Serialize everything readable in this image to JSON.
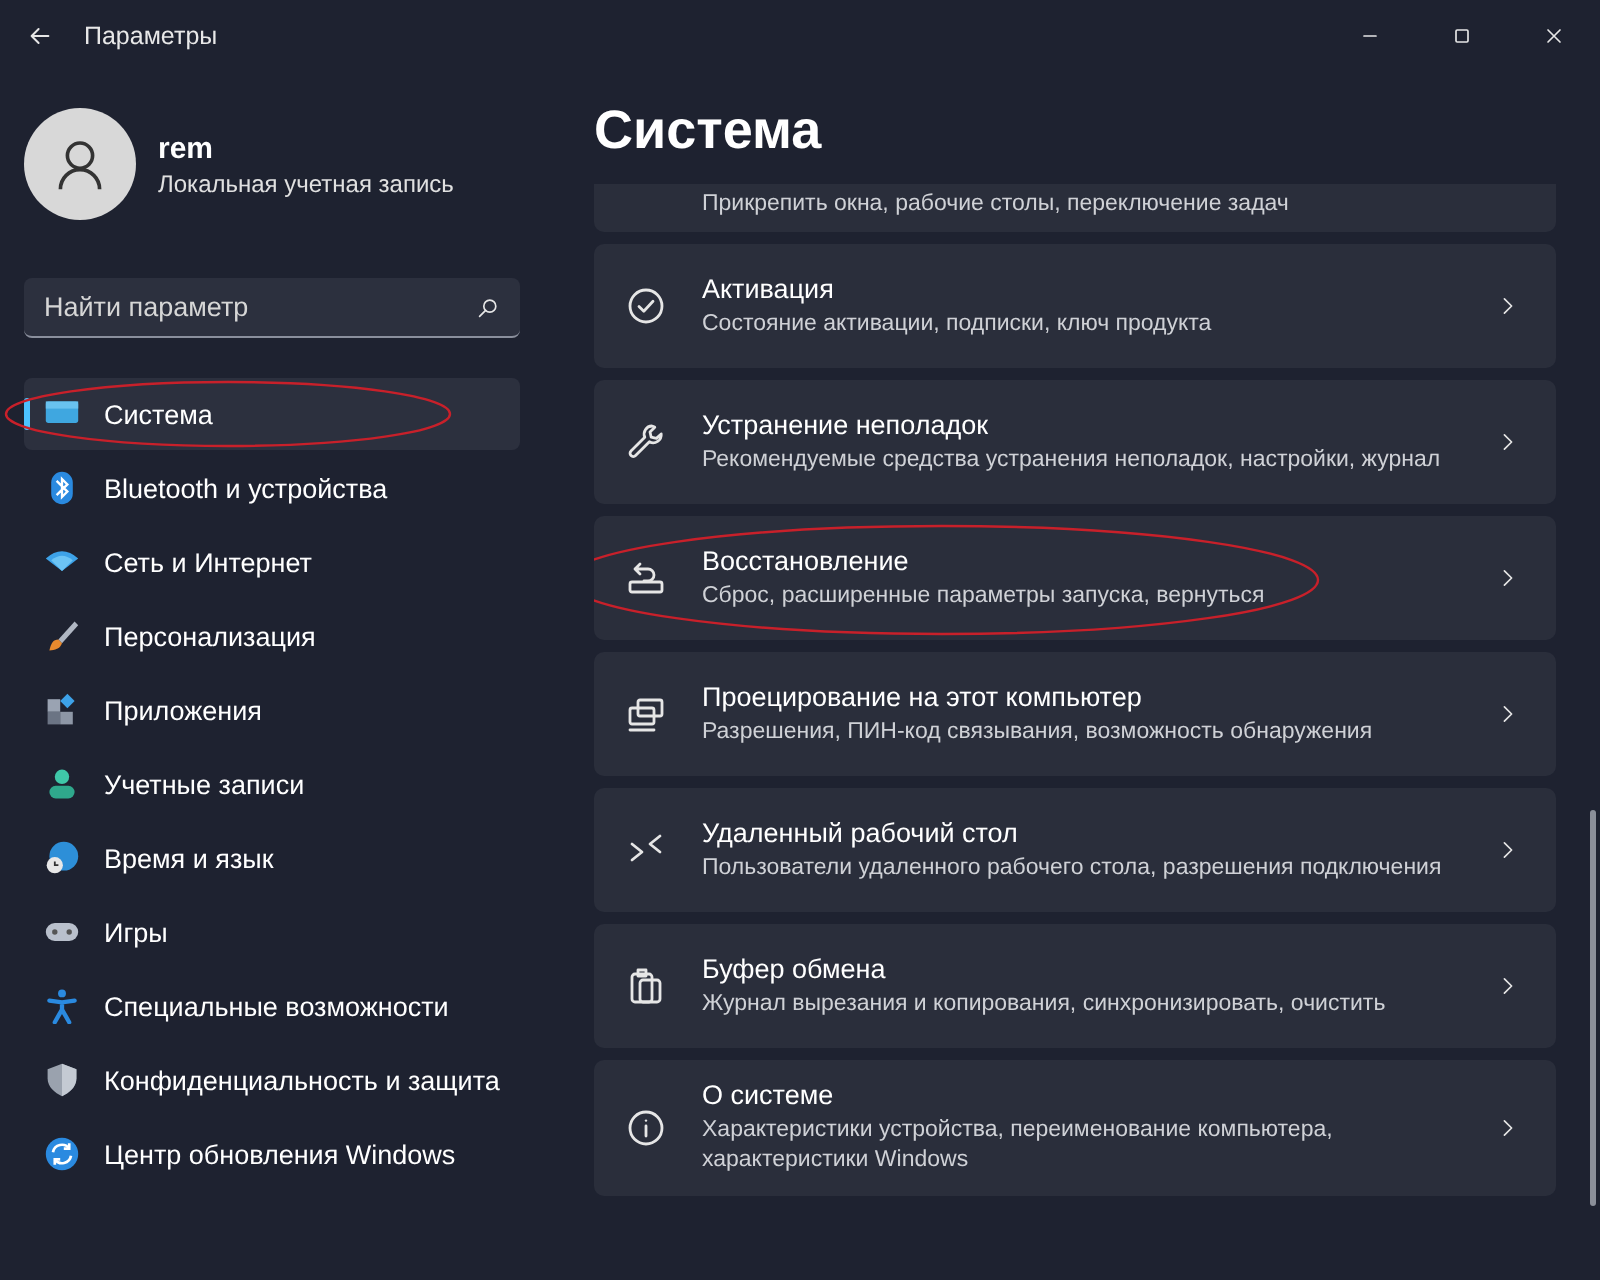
{
  "window": {
    "title": "Параметры"
  },
  "account": {
    "name": "rem",
    "type": "Локальная учетная запись"
  },
  "search": {
    "placeholder": "Найти параметр"
  },
  "nav": [
    {
      "label": "Система",
      "selected": true,
      "annotated": true
    },
    {
      "label": "Bluetooth и устройства",
      "selected": false,
      "annotated": false
    },
    {
      "label": "Сеть и Интернет",
      "selected": false,
      "annotated": false
    },
    {
      "label": "Персонализация",
      "selected": false,
      "annotated": false
    },
    {
      "label": "Приложения",
      "selected": false,
      "annotated": false
    },
    {
      "label": "Учетные записи",
      "selected": false,
      "annotated": false
    },
    {
      "label": "Время и язык",
      "selected": false,
      "annotated": false
    },
    {
      "label": "Игры",
      "selected": false,
      "annotated": false
    },
    {
      "label": "Специальные возможности",
      "selected": false,
      "annotated": false
    },
    {
      "label": "Конфиденциальность и защита",
      "selected": false,
      "annotated": false
    },
    {
      "label": "Центр обновления Windows",
      "selected": false,
      "annotated": false
    }
  ],
  "page": {
    "title": "Система"
  },
  "cards": [
    {
      "kind": "partial",
      "subtitle": "Прикрепить окна, рабочие столы, переключение задач"
    },
    {
      "kind": "full",
      "title": "Активация",
      "subtitle": "Состояние активации, подписки, ключ продукта",
      "annotated": false
    },
    {
      "kind": "full",
      "title": "Устранение неполадок",
      "subtitle": "Рекомендуемые средства устранения неполадок, настройки, журнал",
      "annotated": false
    },
    {
      "kind": "full",
      "title": "Восстановление",
      "subtitle": "Сброс, расширенные параметры запуска, вернуться",
      "annotated": true
    },
    {
      "kind": "full",
      "title": "Проецирование на этот компьютер",
      "subtitle": "Разрешения, ПИН-код связывания, возможность обнаружения",
      "annotated": false
    },
    {
      "kind": "full",
      "title": "Удаленный рабочий стол",
      "subtitle": "Пользователи удаленного рабочего стола, разрешения подключения",
      "annotated": false
    },
    {
      "kind": "full",
      "title": "Буфер обмена",
      "subtitle": "Журнал вырезания и копирования, синхронизировать, очистить",
      "annotated": false
    },
    {
      "kind": "full",
      "title": "О системе",
      "subtitle": "Характеристики устройства, переименование компьютера, характеристики Windows",
      "annotated": false
    }
  ]
}
